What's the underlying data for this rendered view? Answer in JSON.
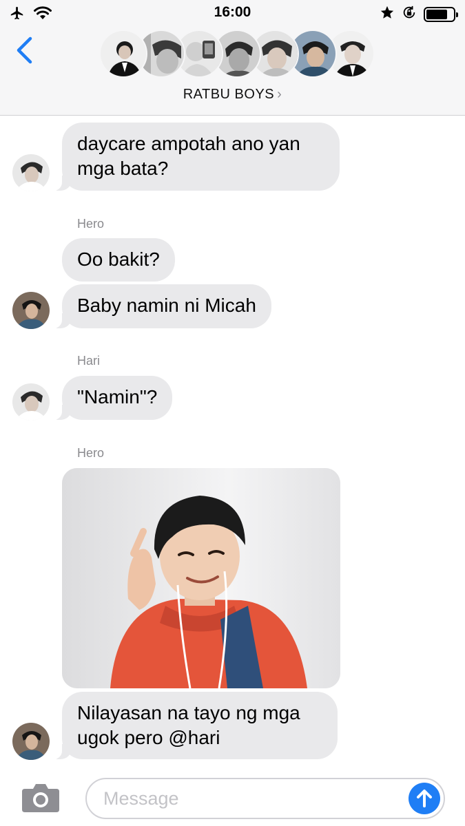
{
  "status_bar": {
    "time": "16:00"
  },
  "header": {
    "group_name": "RATBU BOYS",
    "chevron": "›",
    "avatar_count": 7
  },
  "messages": [
    {
      "sender": "",
      "text": "daycare ampotah ano yan mga bata?"
    },
    {
      "sender": "Hero",
      "text": "Oo bakit?"
    },
    {
      "sender": "",
      "text": "Baby namin ni Micah"
    },
    {
      "sender": "Hari",
      "text": "\"Namin\"?"
    },
    {
      "sender": "Hero",
      "text": ""
    },
    {
      "sender": "",
      "text": "Nilayasan na tayo ng mga ugok pero @hari"
    }
  ],
  "input_bar": {
    "placeholder": "Message"
  },
  "icons": {
    "airplane": "airplane-icon",
    "wifi": "wifi-icon",
    "star": "star-icon",
    "rotation_lock": "rotation-lock-icon",
    "battery": "battery-icon",
    "back": "back-chevron-icon",
    "camera": "camera-icon",
    "send": "send-arrow-icon"
  },
  "colors": {
    "accent": "#1f7ef5",
    "bubble": "#e9e9eb",
    "header_bg": "#f6f6f7",
    "sender_text": "#8a8a8e"
  },
  "battery_level": 0.8
}
